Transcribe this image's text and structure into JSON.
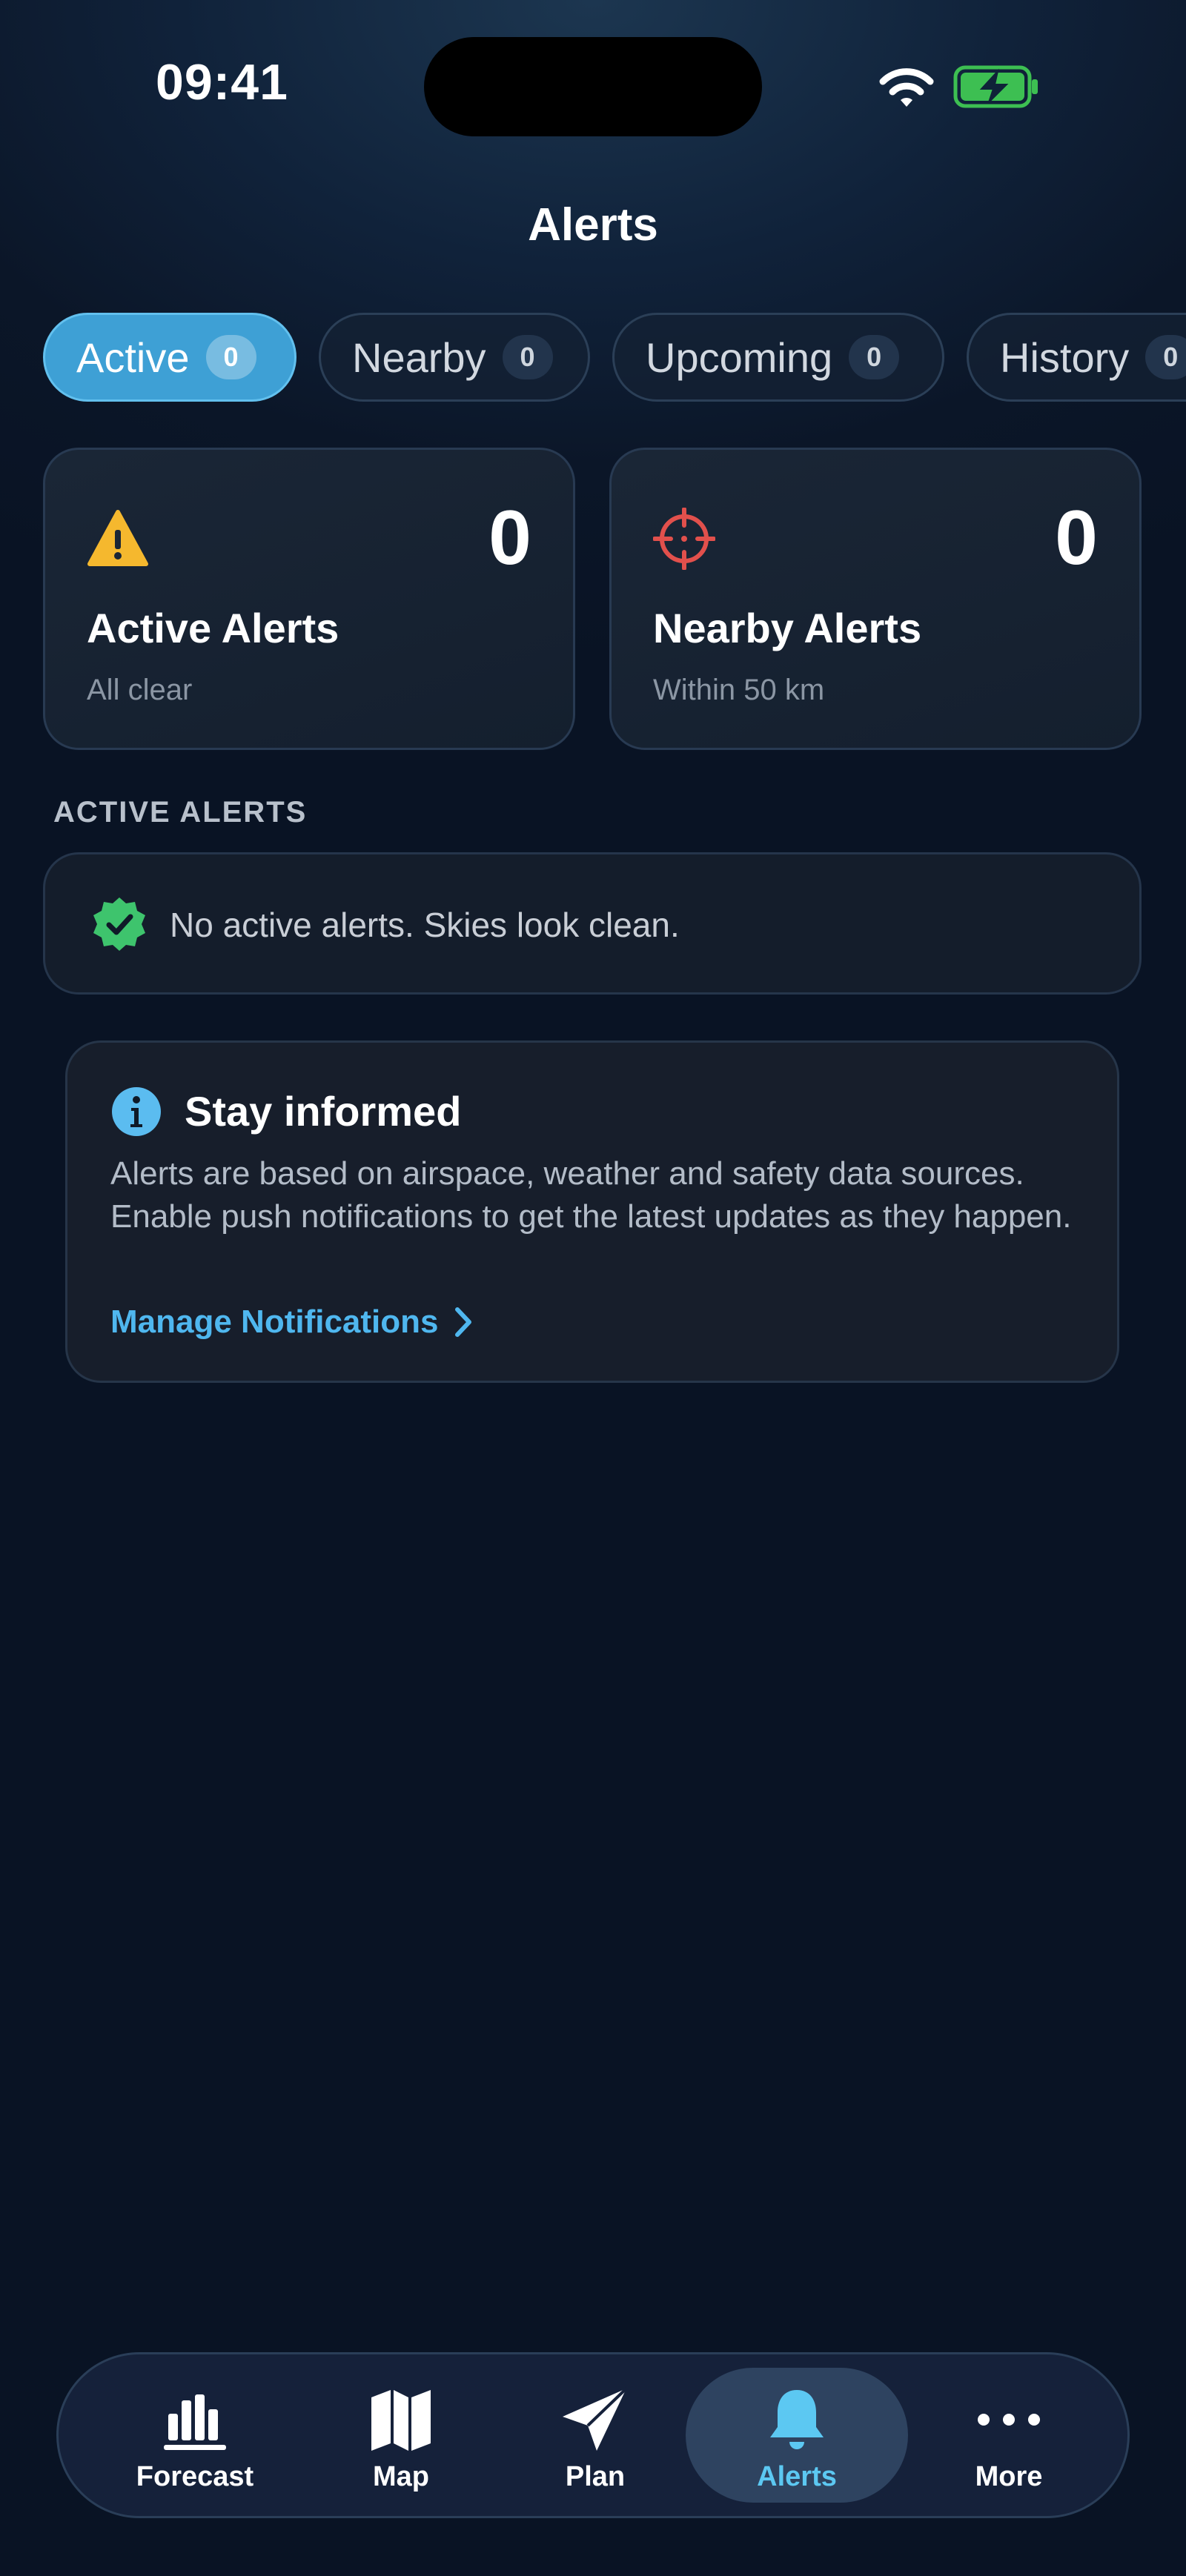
{
  "status_bar": {
    "time": "09:41"
  },
  "header": {
    "title": "Alerts"
  },
  "tabs": [
    {
      "label": "Active",
      "count": "0",
      "active": true
    },
    {
      "label": "Nearby",
      "count": "0",
      "active": false
    },
    {
      "label": "Upcoming",
      "count": "0",
      "active": false
    },
    {
      "label": "History",
      "count": "0",
      "active": false
    }
  ],
  "stats": [
    {
      "icon": "warning-triangle-icon",
      "value": "0",
      "label": "Active Alerts",
      "sub": "All clear",
      "color": "#f5b82e"
    },
    {
      "icon": "crosshair-icon",
      "value": "0",
      "label": "Nearby Alerts",
      "sub": "Within 50 km",
      "color": "#e2504c"
    }
  ],
  "section": {
    "title": "ACTIVE ALERTS"
  },
  "empty_state": {
    "icon": "verified-check-icon",
    "text": "No active alerts. Skies look clean.",
    "color": "#3ec46d"
  },
  "info_card": {
    "icon": "info-icon",
    "title": "Stay informed",
    "body": "Alerts are based on airspace, weather and safety data sources. Enable push notifications to get the latest updates as they happen.",
    "link": "Manage Notifications"
  },
  "nav": [
    {
      "label": "Forecast",
      "icon": "bar-chart-icon",
      "active": false
    },
    {
      "label": "Map",
      "icon": "map-icon",
      "active": false
    },
    {
      "label": "Plan",
      "icon": "paper-plane-icon",
      "active": false
    },
    {
      "label": "Alerts",
      "icon": "bell-icon",
      "active": true
    },
    {
      "label": "More",
      "icon": "more-dots-icon",
      "active": false
    }
  ],
  "colors": {
    "accent": "#3ea0d5",
    "link": "#4fb7ef",
    "active_nav": "#5cc8f2"
  }
}
